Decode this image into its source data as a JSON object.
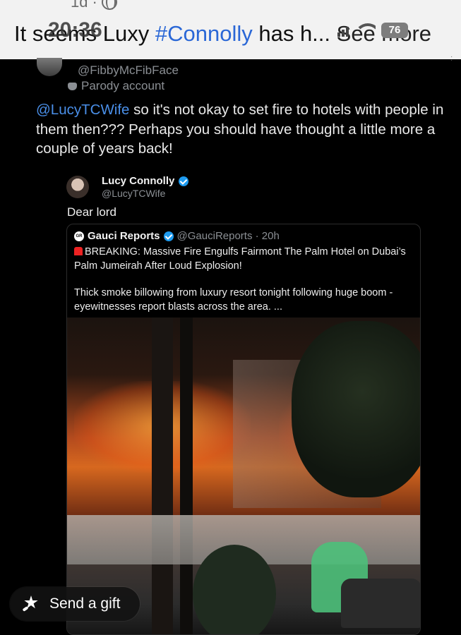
{
  "header": {
    "time_ago": "1d",
    "clock": "20:36",
    "headline_start": "It seems Luxy ",
    "hashtag": "#Connolly",
    "headline_end": " has h... ",
    "see_more": "See more",
    "battery": "76"
  },
  "reply": {
    "handle": "@FibbyMcFibFace",
    "parody_label": "Parody account",
    "mention": "@LucyTCWife",
    "text": " so it's not okay to set fire to hotels with people in them then??? Perhaps you should have thought a little more a couple of years back!"
  },
  "quote": {
    "name": "Lucy Connolly",
    "handle": "@LucyTCWife",
    "text": "Dear lord",
    "inner": {
      "name": "Gauci Reports",
      "handle_time": "@GauciReports · 20h",
      "headline": "BREAKING: Massive Fire Engulfs Fairmont The Palm Hotel on Dubai’s Palm Jumeirah After Loud Explosion!",
      "body": "Thick smoke billowing from luxury resort tonight following huge boom - eyewitnesses report blasts across the area. ..."
    }
  },
  "gift": {
    "label": "Send a gift"
  },
  "icons": {
    "globe": "globe-icon",
    "wifi": "wifi-icon",
    "signal": "signal-icon",
    "battery": "battery-icon",
    "parody": "mask-icon",
    "verified": "verified-icon",
    "siren": "siren-icon",
    "gift": "gift-icon"
  },
  "colors": {
    "background": "#000000",
    "mention": "#4a8fe8",
    "hashtag": "#2a67d6",
    "verified": "#1d9bf0"
  }
}
